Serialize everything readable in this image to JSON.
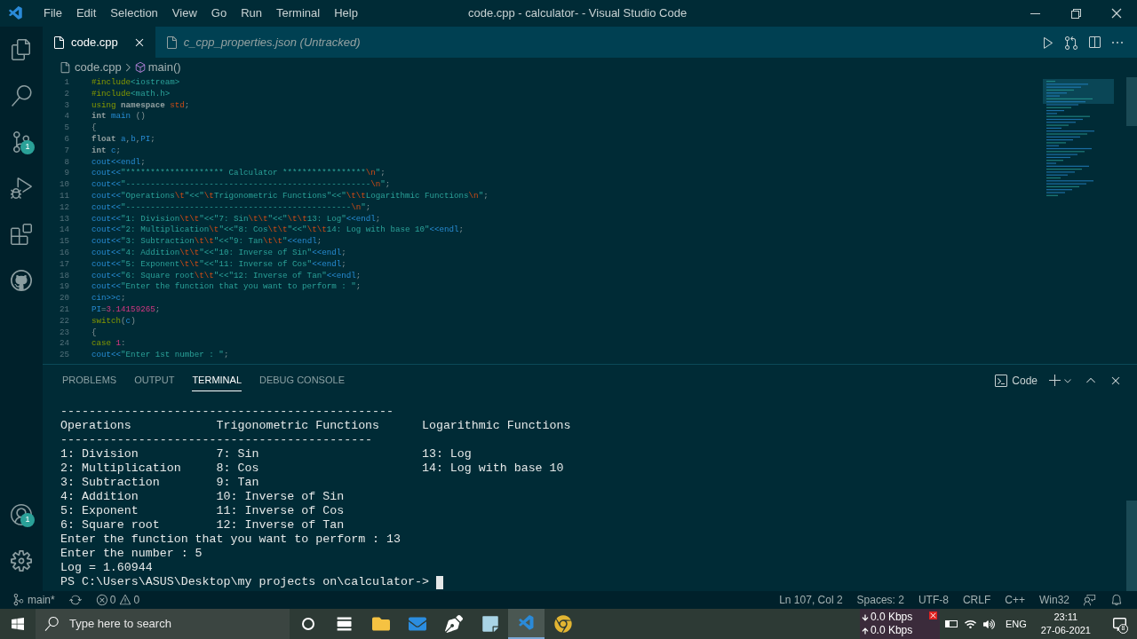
{
  "window_title": "code.cpp - calculator- - Visual Studio Code",
  "menu": [
    "File",
    "Edit",
    "Selection",
    "View",
    "Go",
    "Run",
    "Terminal",
    "Help"
  ],
  "activity_bar": [
    {
      "kind": "files"
    },
    {
      "kind": "search"
    },
    {
      "kind": "scm",
      "badge": "1"
    },
    {
      "kind": "debug"
    },
    {
      "kind": "extensions"
    },
    {
      "kind": "github"
    }
  ],
  "activity_bottom": [
    {
      "kind": "account",
      "badge": "1"
    },
    {
      "kind": "settings"
    }
  ],
  "tabs": [
    {
      "label": "code.cpp",
      "selected": true,
      "preview": false
    },
    {
      "label": "c_cpp_properties.json (Untracked)",
      "selected": false,
      "preview": true
    }
  ],
  "breadcrumbs": [
    "code.cpp",
    "main()"
  ],
  "code_lines": [
    {
      "n": "1",
      "tokens": [
        {
          "kind": "pre",
          "text": "#include"
        },
        {
          "kind": "str",
          "text": "<iostream>"
        }
      ]
    },
    {
      "n": "2",
      "tokens": [
        {
          "kind": "pre",
          "text": "#include"
        },
        {
          "kind": "str",
          "text": "<math.h>"
        }
      ]
    },
    {
      "n": "3",
      "tokens": [
        {
          "kind": "ctrl",
          "text": "using "
        },
        {
          "kind": "kw",
          "text": "namespace "
        },
        {
          "kind": "esc",
          "text": "std"
        },
        {
          "kind": "plain",
          "text": ";"
        }
      ]
    },
    {
      "n": "4",
      "tokens": [
        {
          "kind": "kw",
          "text": "int "
        },
        {
          "kind": "id",
          "text": "main "
        },
        {
          "kind": "plain",
          "text": "()"
        }
      ]
    },
    {
      "n": "5",
      "tokens": [
        {
          "kind": "plain",
          "text": "{"
        }
      ]
    },
    {
      "n": "6",
      "tokens": [
        {
          "kind": "kw",
          "text": "float "
        },
        {
          "kind": "id",
          "text": "a"
        },
        {
          "kind": "plain",
          "text": ","
        },
        {
          "kind": "id",
          "text": "b"
        },
        {
          "kind": "plain",
          "text": ","
        },
        {
          "kind": "id",
          "text": "PI"
        },
        {
          "kind": "plain",
          "text": ";"
        }
      ]
    },
    {
      "n": "7",
      "tokens": [
        {
          "kind": "kw",
          "text": "int "
        },
        {
          "kind": "id",
          "text": "c"
        },
        {
          "kind": "plain",
          "text": ";"
        }
      ]
    },
    {
      "n": "8",
      "tokens": [
        {
          "kind": "id",
          "text": "cout<<endl"
        },
        {
          "kind": "plain",
          "text": ";"
        }
      ]
    },
    {
      "n": "9",
      "tokens": [
        {
          "kind": "id",
          "text": "cout<<"
        },
        {
          "kind": "str",
          "text": "\"******************** Calculator *****************"
        },
        {
          "kind": "esc",
          "text": "\\n"
        },
        {
          "kind": "str",
          "text": "\""
        },
        {
          "kind": "plain",
          "text": ";"
        }
      ]
    },
    {
      "n": "10",
      "tokens": [
        {
          "kind": "id",
          "text": "cout<<"
        },
        {
          "kind": "str",
          "text": "\"--------------------------------------------------"
        },
        {
          "kind": "esc",
          "text": "\\n"
        },
        {
          "kind": "str",
          "text": "\""
        },
        {
          "kind": "plain",
          "text": ";"
        }
      ]
    },
    {
      "n": "11",
      "tokens": [
        {
          "kind": "id",
          "text": "cout<<"
        },
        {
          "kind": "str",
          "text": "\"Operations"
        },
        {
          "kind": "esc",
          "text": "\\t"
        },
        {
          "kind": "str",
          "text": "\"<<\""
        },
        {
          "kind": "esc",
          "text": "\\t"
        },
        {
          "kind": "str",
          "text": "Trigonometric Functions\"<<\""
        },
        {
          "kind": "esc",
          "text": "\\t\\t"
        },
        {
          "kind": "str",
          "text": "Logarithmic Functions"
        },
        {
          "kind": "esc",
          "text": "\\n"
        },
        {
          "kind": "str",
          "text": "\""
        },
        {
          "kind": "plain",
          "text": ";"
        }
      ]
    },
    {
      "n": "12",
      "tokens": [
        {
          "kind": "id",
          "text": "cout<<"
        },
        {
          "kind": "str",
          "text": "\"----------------------------------------------"
        },
        {
          "kind": "esc",
          "text": "\\n"
        },
        {
          "kind": "str",
          "text": "\""
        },
        {
          "kind": "plain",
          "text": ";"
        }
      ]
    },
    {
      "n": "13",
      "tokens": [
        {
          "kind": "id",
          "text": "cout<<"
        },
        {
          "kind": "str",
          "text": "\"1: Division"
        },
        {
          "kind": "esc",
          "text": "\\t\\t"
        },
        {
          "kind": "str",
          "text": "\"<<\"7: Sin"
        },
        {
          "kind": "esc",
          "text": "\\t\\t"
        },
        {
          "kind": "str",
          "text": "\"<<\""
        },
        {
          "kind": "esc",
          "text": "\\t\\t"
        },
        {
          "kind": "str",
          "text": "13: Log\""
        },
        {
          "kind": "id",
          "text": "<<endl"
        },
        {
          "kind": "plain",
          "text": ";"
        }
      ]
    },
    {
      "n": "14",
      "tokens": [
        {
          "kind": "id",
          "text": "cout<<"
        },
        {
          "kind": "str",
          "text": "\"2: Multiplication"
        },
        {
          "kind": "esc",
          "text": "\\t"
        },
        {
          "kind": "str",
          "text": "\"<<\"8: Cos"
        },
        {
          "kind": "esc",
          "text": "\\t\\t"
        },
        {
          "kind": "str",
          "text": "\"<<\""
        },
        {
          "kind": "esc",
          "text": "\\t\\t"
        },
        {
          "kind": "str",
          "text": "14: Log with base 10\""
        },
        {
          "kind": "id",
          "text": "<<endl"
        },
        {
          "kind": "plain",
          "text": ";"
        }
      ]
    },
    {
      "n": "15",
      "tokens": [
        {
          "kind": "id",
          "text": "cout<<"
        },
        {
          "kind": "str",
          "text": "\"3: Subtraction"
        },
        {
          "kind": "esc",
          "text": "\\t\\t"
        },
        {
          "kind": "str",
          "text": "\"<<\"9: Tan"
        },
        {
          "kind": "esc",
          "text": "\\t\\t"
        },
        {
          "kind": "str",
          "text": "\""
        },
        {
          "kind": "id",
          "text": "<<endl"
        },
        {
          "kind": "plain",
          "text": ";"
        }
      ]
    },
    {
      "n": "16",
      "tokens": [
        {
          "kind": "id",
          "text": "cout<<"
        },
        {
          "kind": "str",
          "text": "\"4: Addition"
        },
        {
          "kind": "esc",
          "text": "\\t\\t"
        },
        {
          "kind": "str",
          "text": "\"<<\"10: Inverse of Sin\""
        },
        {
          "kind": "id",
          "text": "<<endl"
        },
        {
          "kind": "plain",
          "text": ";"
        }
      ]
    },
    {
      "n": "17",
      "tokens": [
        {
          "kind": "id",
          "text": "cout<<"
        },
        {
          "kind": "str",
          "text": "\"5: Exponent"
        },
        {
          "kind": "esc",
          "text": "\\t\\t"
        },
        {
          "kind": "str",
          "text": "\"<<\"11: Inverse of Cos\""
        },
        {
          "kind": "id",
          "text": "<<endl"
        },
        {
          "kind": "plain",
          "text": ";"
        }
      ]
    },
    {
      "n": "18",
      "tokens": [
        {
          "kind": "id",
          "text": "cout<<"
        },
        {
          "kind": "str",
          "text": "\"6: Square root"
        },
        {
          "kind": "esc",
          "text": "\\t\\t"
        },
        {
          "kind": "str",
          "text": "\"<<\"12: Inverse of Tan\""
        },
        {
          "kind": "id",
          "text": "<<endl"
        },
        {
          "kind": "plain",
          "text": ";"
        }
      ]
    },
    {
      "n": "19",
      "tokens": [
        {
          "kind": "id",
          "text": "cout<<"
        },
        {
          "kind": "str",
          "text": "\"Enter the function that you want to perform : \""
        },
        {
          "kind": "plain",
          "text": ";"
        }
      ]
    },
    {
      "n": "20",
      "tokens": [
        {
          "kind": "id",
          "text": "cin>>c"
        },
        {
          "kind": "plain",
          "text": ";"
        }
      ]
    },
    {
      "n": "21",
      "tokens": [
        {
          "kind": "id",
          "text": "PI"
        },
        {
          "kind": "plain",
          "text": "="
        },
        {
          "kind": "num",
          "text": "3.14159265"
        },
        {
          "kind": "plain",
          "text": ";"
        }
      ]
    },
    {
      "n": "22",
      "tokens": [
        {
          "kind": "ctrl",
          "text": "switch"
        },
        {
          "kind": "plain",
          "text": "("
        },
        {
          "kind": "id",
          "text": "c"
        },
        {
          "kind": "plain",
          "text": ")"
        }
      ]
    },
    {
      "n": "23",
      "tokens": [
        {
          "kind": "plain",
          "text": "{"
        }
      ]
    },
    {
      "n": "24",
      "tokens": [
        {
          "kind": "ctrl",
          "text": "case "
        },
        {
          "kind": "num",
          "text": "1"
        },
        {
          "kind": "plain",
          "text": ":"
        }
      ]
    },
    {
      "n": "25",
      "tokens": [
        {
          "kind": "id",
          "text": "cout<<"
        },
        {
          "kind": "str",
          "text": "\"Enter 1st number : \""
        },
        {
          "kind": "plain",
          "text": ";"
        }
      ]
    }
  ],
  "panel_tabs": [
    {
      "label": "PROBLEMS",
      "selected": false
    },
    {
      "label": "OUTPUT",
      "selected": false
    },
    {
      "label": "TERMINAL",
      "selected": true
    },
    {
      "label": "DEBUG CONSOLE",
      "selected": false
    }
  ],
  "terminal_name": "Code",
  "terminal_lines": [
    "-----------------------------------------------",
    "Operations            Trigonometric Functions      Logarithmic Functions",
    "--------------------------------------------",
    "1: Division           7: Sin                       13: Log",
    "2: Multiplication     8: Cos                       14: Log with base 10",
    "3: Subtraction        9: Tan",
    "4: Addition           10: Inverse of Sin",
    "5: Exponent           11: Inverse of Cos",
    "6: Square root        12: Inverse of Tan",
    "Enter the function that you want to perform : 13",
    "Enter the number : 5",
    "Log = 1.60944",
    "PS C:\\Users\\ASUS\\Desktop\\my projects on\\calculator-> "
  ],
  "status_bar": {
    "branch": "main*",
    "errors": "0",
    "warnings": "0",
    "items": [
      "Ln 107, Col 2",
      "Spaces: 2",
      "UTF-8",
      "CRLF",
      "C++",
      "Win32"
    ]
  },
  "taskbar": {
    "search_placeholder": "Type here to search",
    "apps": [
      {
        "kind": "cortana",
        "selected": false
      },
      {
        "kind": "taskview",
        "selected": false
      },
      {
        "kind": "explorer",
        "selected": false
      },
      {
        "kind": "mail",
        "selected": false
      },
      {
        "kind": "pen",
        "selected": false
      },
      {
        "kind": "notepad",
        "selected": false
      },
      {
        "kind": "vscode",
        "selected": true
      },
      {
        "kind": "chrome",
        "selected": false
      }
    ],
    "net_down": "0.0 Kbps",
    "net_up": "0.0 Kbps",
    "language": "ENG",
    "time": "23:11",
    "date": "27-06-2021",
    "notifications": "8"
  }
}
